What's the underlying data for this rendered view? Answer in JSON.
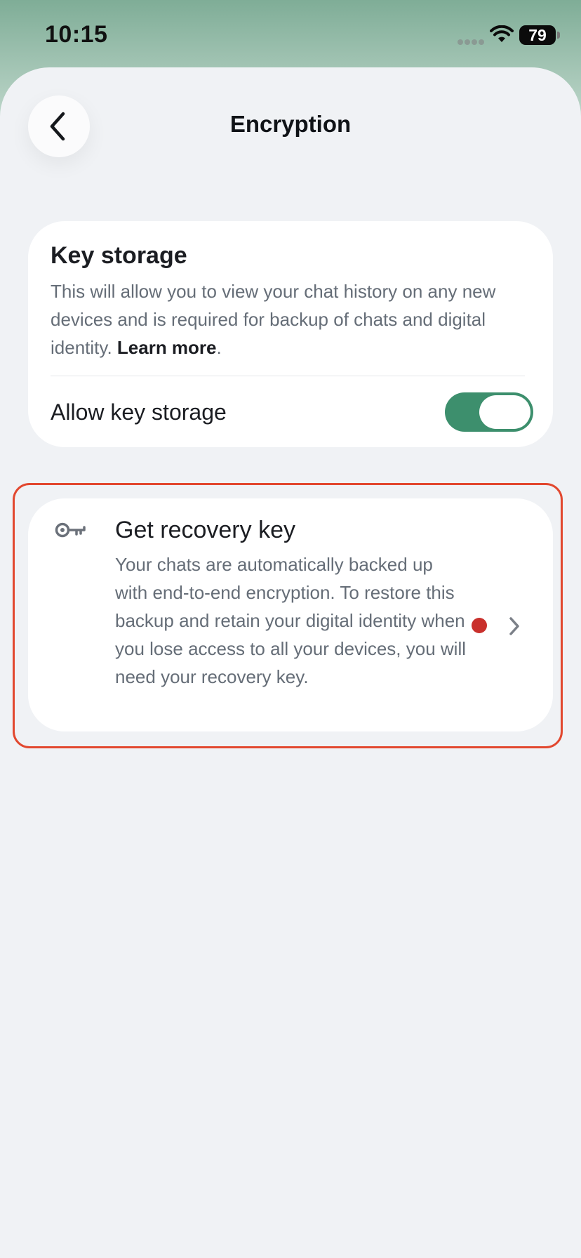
{
  "status_bar": {
    "time": "10:15",
    "battery": "79",
    "icons": [
      "signal-icon",
      "wifi-icon",
      "battery-icon"
    ]
  },
  "header": {
    "title": "Encryption",
    "back_icon": "chevron-left-icon"
  },
  "key_storage": {
    "title": "Key storage",
    "description": "This will allow you to view your chat history on any new devices and is required for backup of chats and digital identity. ",
    "learn_more": "Learn more",
    "period": ".",
    "toggle_label": "Allow key storage",
    "toggle_on": true,
    "toggle_color": "#3d8f6d"
  },
  "recovery": {
    "icon": "key-icon",
    "title": "Get recovery key",
    "description": "Your chats are automatically backed up with end-to-end encryption. To restore this backup and retain your digital identity when you lose access to all your devices, you will need your recovery key.",
    "indicator_color": "#c9302c",
    "chevron_icon": "chevron-right-icon",
    "highlight_color": "#e2482f"
  }
}
